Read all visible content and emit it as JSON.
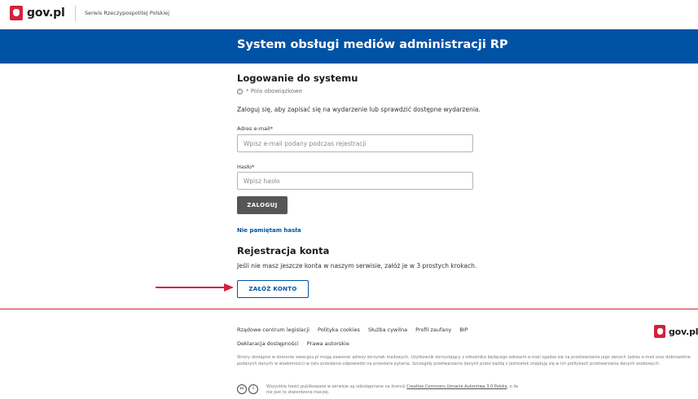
{
  "header": {
    "logo_text": "gov.pl",
    "service_name": "Serwis Rzeczypospolitej Polskiej"
  },
  "banner": {
    "title": "System obsługi mediów administracji RP"
  },
  "login": {
    "heading": "Logowanie do systemu",
    "required_note": "* Pola obowiązkowe",
    "intro": "Zaloguj się, aby zapisać się na wydarzenie lub sprawdzić dostępne wydarzenia.",
    "email_label": "Adres e-mail*",
    "email_placeholder": "Wpisz e-mail podany podczas rejestracji",
    "password_label": "Hasło*",
    "password_placeholder": "Wpisz hasło",
    "login_button": "ZALOGUJ",
    "forgot_link": "Nie pamiętam hasła"
  },
  "registration": {
    "heading": "Rejestracja konta",
    "description": "Jeśli nie masz jeszcze konta w naszym serwisie, załóż je w 3 prostych krokach.",
    "button": "ZAŁÓŻ KONTO"
  },
  "footer": {
    "links_row1": [
      "Rządowe centrum legislacji",
      "Polityka cookies",
      "Służba cywilna",
      "Profil zaufany",
      "BIP"
    ],
    "links_row2": [
      "Deklaracja dostępności",
      "Prawa autorskie"
    ],
    "logo_text": "gov.pl",
    "privacy_text": "Strony dostępne w domenie www.gov.pl mogą zawierać adresy skrzynek mailowych. Użytkownik korzystający z odnośnika będącego adresem e-mail zgadza się na przetwarzanie jego danych (adres e-mail oraz dobrowolnie podanych danych w wiadomości) w celu przesłania odpowiedzi na przesłane pytania. Szczegóły przetwarzania danych przez każdą z jednostek znajdują się w ich politykach przetwarzania danych osobowych.",
    "license_text_before": "Wszystkie treści publikowane w serwisie są udostępniane na licencji",
    "license_link": "Creative Commons Uznanie Autorstwa 3.0 Polska",
    "license_text_after": ", o ile",
    "license_text_line2": "nie jest to stwierdzone inaczej.",
    "cc_icon_label": "cc",
    "by_icon_label": "i"
  },
  "colors": {
    "brand_blue": "#0052a5",
    "brand_red": "#d4213d",
    "button_gray": "#565656"
  }
}
